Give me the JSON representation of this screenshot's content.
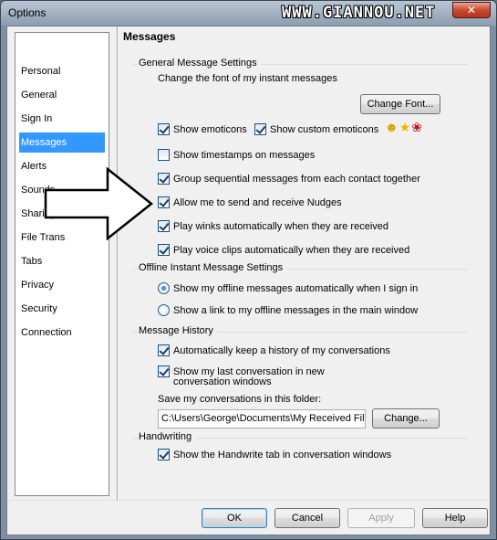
{
  "window": {
    "title": "Options",
    "watermark": "WWW.GIANNOU.NET",
    "close_glyph": "✕"
  },
  "nav": {
    "items": [
      {
        "label": "Personal"
      },
      {
        "label": "General"
      },
      {
        "label": "Sign In"
      },
      {
        "label": "Messages",
        "selected": true
      },
      {
        "label": "Alerts"
      },
      {
        "label": "Sounds"
      },
      {
        "label": "Sharing F"
      },
      {
        "label": "File Trans"
      },
      {
        "label": "Tabs"
      },
      {
        "label": "Privacy"
      },
      {
        "label": "Security"
      },
      {
        "label": "Connection"
      }
    ]
  },
  "messages": {
    "title": "Messages",
    "general": {
      "group_label": "General Message Settings",
      "font_text": "Change the font of my instant messages",
      "change_font_button": "Change Font...",
      "show_emoticons": {
        "label": "Show emoticons",
        "checked": true
      },
      "show_custom_emoticons": {
        "label": "Show custom emoticons",
        "checked": true
      },
      "emoticon_icons": [
        "smiley-icon",
        "star-icon",
        "rose-icon"
      ],
      "show_timestamps": {
        "label": "Show timestamps on messages",
        "checked": false
      },
      "group_sequential": {
        "label": "Group sequential messages from each contact together",
        "checked": true
      },
      "allow_nudges": {
        "label": "Allow me to send and receive Nudges",
        "checked": true
      },
      "play_winks": {
        "label": "Play winks automatically when they are received",
        "checked": true
      },
      "play_voice_clips": {
        "label": "Play voice clips automatically when they are received",
        "checked": true
      }
    },
    "offline": {
      "group_label": "Offline Instant Message Settings",
      "option_auto": {
        "label": "Show my offline messages automatically when I sign in",
        "checked": true
      },
      "option_link": {
        "label": "Show a link to my offline messages in the main window",
        "checked": false
      }
    },
    "history": {
      "group_label": "Message History",
      "keep_history": {
        "label": "Automatically keep a history of my conversations",
        "checked": true
      },
      "show_last_line1": "Show my last conversation in new",
      "show_last_line2": "conversation windows",
      "show_last_checked": true,
      "save_folder_label": "Save my conversations in this folder:",
      "folder_path": "C:\\Users\\George\\Documents\\My Received Fil",
      "change_button": "Change..."
    },
    "handwriting": {
      "group_label": "Handwriting",
      "show_handwrite_tab": {
        "label": "Show the Handwrite tab in conversation windows",
        "checked": true
      }
    }
  },
  "footer": {
    "ok": "OK",
    "cancel": "Cancel",
    "apply": "Apply",
    "help": "Help"
  },
  "colors": {
    "selection": "#3399ff",
    "close_button": "#c84a33"
  }
}
